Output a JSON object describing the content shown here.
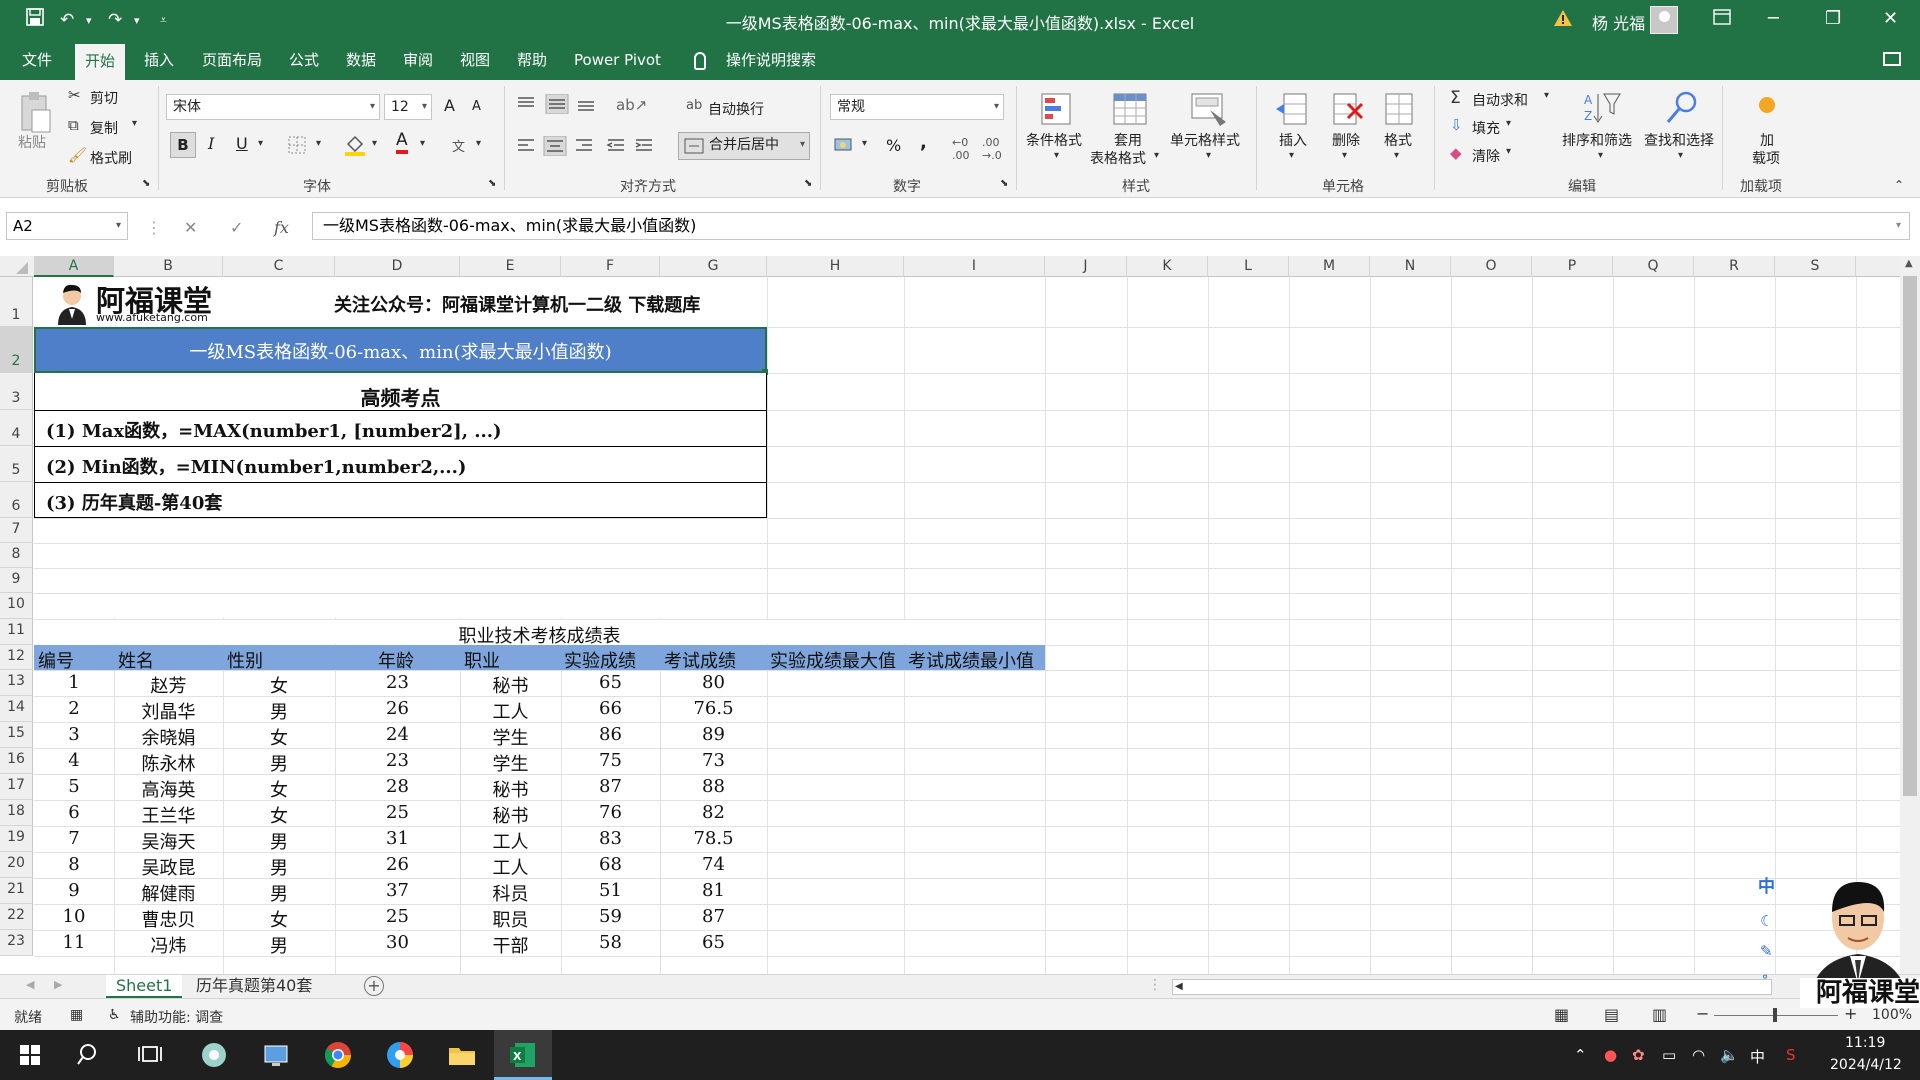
{
  "window": {
    "title": "一级MS表格函数-06-max、min(求最大最小值函数).xlsx  -  Excel",
    "user": "杨 光福",
    "minimize": "─",
    "restore": "❐",
    "close": "✕"
  },
  "menu": [
    "文件",
    "开始",
    "插入",
    "页面布局",
    "公式",
    "数据",
    "审阅",
    "视图",
    "帮助",
    "Power Pivot",
    "操作说明搜索"
  ],
  "ribbon": {
    "clipboard": {
      "cut": "剪切",
      "copy": "复制",
      "format_painter": "格式刷",
      "paste": "粘贴",
      "label": "剪贴板"
    },
    "font": {
      "name": "宋体",
      "size": "12",
      "label": "字体",
      "bold": "B",
      "italic": "I",
      "underline": "U",
      "font_color": "A",
      "grow": "A",
      "shrink": "A"
    },
    "alignment": {
      "wrap": "自动换行",
      "merge": "合并后居中",
      "label": "对齐方式"
    },
    "number": {
      "format": "常规",
      "percent": "%",
      "comma": ",",
      "label": "数字"
    },
    "styles": {
      "conditional": "条件格式",
      "table1": "套用",
      "table2": "表格格式",
      "cell_styles": "单元格样式",
      "label": "样式"
    },
    "cells": {
      "insert": "插入",
      "delete": "删除",
      "format": "格式",
      "label": "单元格"
    },
    "editing": {
      "autosum": "自动求和",
      "fill": "填充",
      "clear": "清除",
      "sort": "排序和筛选",
      "find": "查找和选择",
      "label": "编辑"
    },
    "addins": {
      "line1": "加",
      "line2": "载项",
      "label": "加载项"
    }
  },
  "formula_bar": {
    "name_box": "A2",
    "fx": "fx",
    "cancel": "✕",
    "enter": "✓",
    "content": "一级MS表格函数-06-max、min(求最大最小值函数)"
  },
  "columns": [
    "A",
    "B",
    "C",
    "D",
    "E",
    "F",
    "G",
    "H",
    "I",
    "J",
    "K",
    "L",
    "M",
    "N",
    "O",
    "P",
    "Q",
    "R",
    "S"
  ],
  "rows": [
    "1",
    "2",
    "3",
    "4",
    "5",
    "6",
    "7",
    "8",
    "9",
    "10",
    "11",
    "12",
    "13",
    "14",
    "15",
    "16",
    "17",
    "18",
    "19",
    "20",
    "21",
    "22",
    "23"
  ],
  "sheet": {
    "logo_text": "阿福课堂",
    "logo_url": "www.afuketang.com",
    "follow": "关注公众号：阿福课堂计算机一二级  下载题库",
    "banner": "一级MS表格函数-06-max、min(求最大最小值函数)",
    "key_points_title": "高频考点",
    "point1": "(1) Max函数，=MAX(number1, [number2], ...)",
    "point2": "(2) Min函数，=MIN(number1,number2,...)",
    "point3": "(3) 历年真题-第40套",
    "table_title": "职业技术考核成绩表",
    "headers": [
      "编号",
      "姓名",
      "性别",
      "年龄",
      "职业",
      "实验成绩",
      "考试成绩",
      "实验成绩最大值",
      "考试成绩最小值"
    ],
    "data": [
      [
        "1",
        "赵芳",
        "女",
        "23",
        "秘书",
        "65",
        "80"
      ],
      [
        "2",
        "刘晶华",
        "男",
        "26",
        "工人",
        "66",
        "76.5"
      ],
      [
        "3",
        "余晓娟",
        "女",
        "24",
        "学生",
        "86",
        "89"
      ],
      [
        "4",
        "陈永林",
        "男",
        "23",
        "学生",
        "75",
        "73"
      ],
      [
        "5",
        "高海英",
        "女",
        "28",
        "秘书",
        "87",
        "88"
      ],
      [
        "6",
        "王兰华",
        "女",
        "25",
        "秘书",
        "76",
        "82"
      ],
      [
        "7",
        "吴海天",
        "男",
        "31",
        "工人",
        "83",
        "78.5"
      ],
      [
        "8",
        "吴政昆",
        "男",
        "26",
        "工人",
        "68",
        "74"
      ],
      [
        "9",
        "解健雨",
        "男",
        "37",
        "科员",
        "51",
        "81"
      ],
      [
        "10",
        "曹忠贝",
        "女",
        "25",
        "职员",
        "59",
        "87"
      ],
      [
        "11",
        "冯炜",
        "男",
        "30",
        "干部",
        "58",
        "65"
      ]
    ]
  },
  "sheet_tabs": [
    "Sheet1",
    "历年真题第40套"
  ],
  "status": {
    "ready": "就绪",
    "accessibility": "辅助功能: 调查",
    "zoom": "100%"
  },
  "taskbar": {
    "time": "11:19",
    "date": "2024/4/12",
    "ime": "中"
  },
  "watermark": {
    "text": "阿福课堂"
  },
  "ime_float": {
    "label": "中"
  },
  "colors": {
    "excel_green": "#217346",
    "header_fill": "#7ea6dc",
    "banner_fill": "#4f7fc8"
  }
}
